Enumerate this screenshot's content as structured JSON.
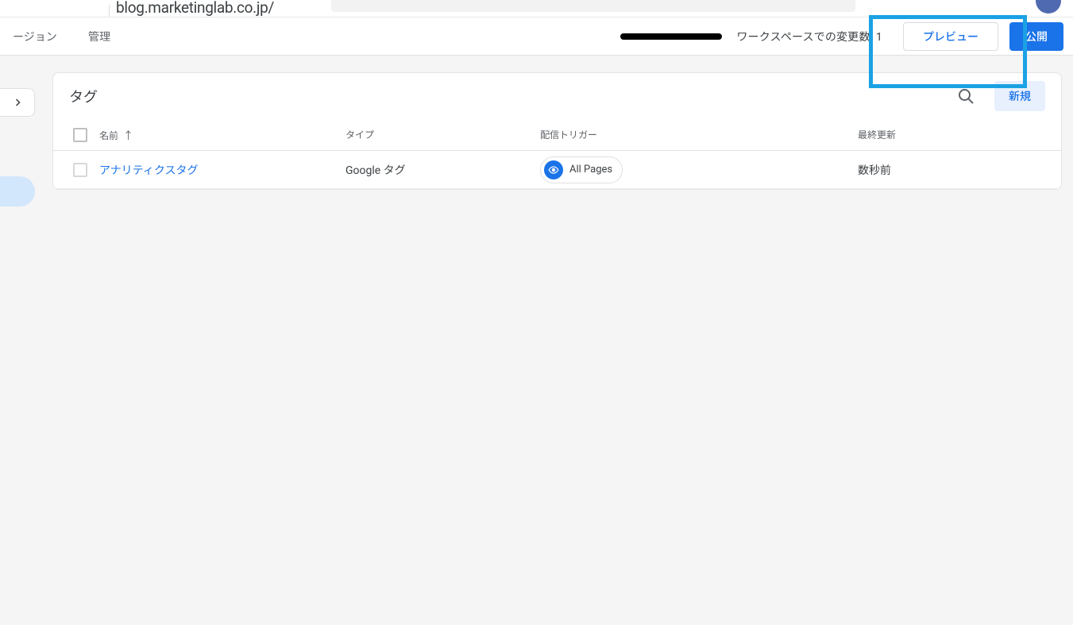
{
  "header": {
    "url": "blog.marketinglab.co.jp/"
  },
  "subnav": {
    "version": "ージョン",
    "admin": "管理",
    "workspace_label": "ワークスペースでの変更数:",
    "workspace_count": "1",
    "preview": "プレビュー",
    "publish": "公開"
  },
  "card": {
    "title": "タグ",
    "new_button": "新規",
    "columns": {
      "name": "名前",
      "type": "タイプ",
      "trigger": "配信トリガー",
      "updated": "最終更新"
    },
    "rows": [
      {
        "name": "アナリティクスタグ",
        "type": "Google タグ",
        "trigger": "All Pages",
        "updated": "数秒前"
      }
    ]
  }
}
